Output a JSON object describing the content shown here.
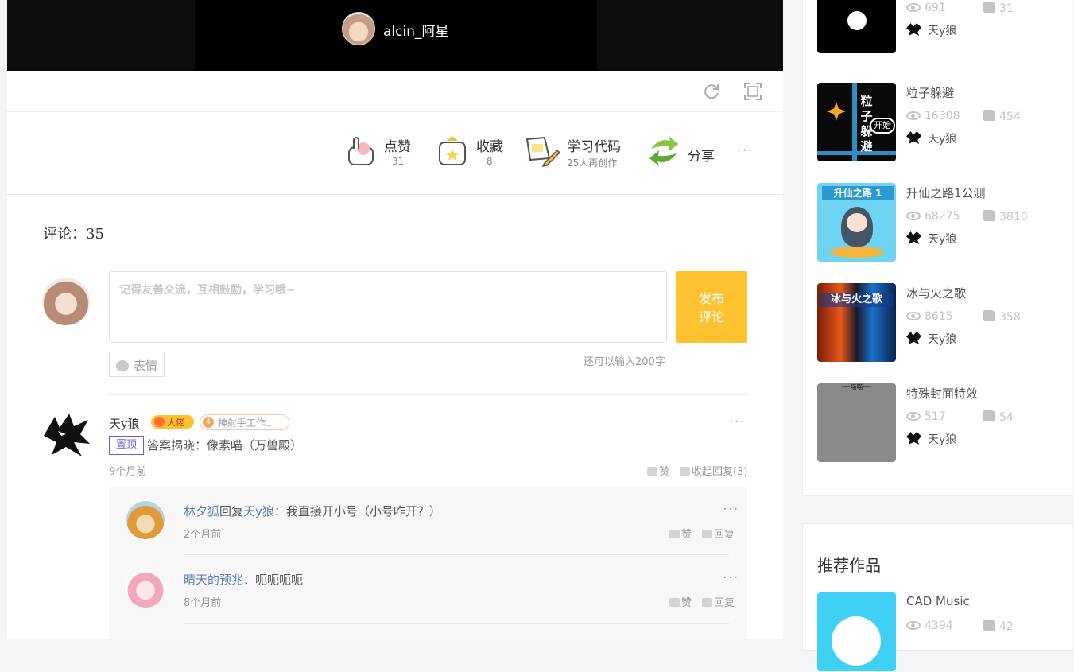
{
  "player": {
    "author_name": "alcin_阿星"
  },
  "actions": {
    "like_label": "点赞",
    "like_count": "31",
    "fav_label": "收藏",
    "fav_count": "8",
    "learn_label": "学习代码",
    "learn_sub": "25人再创作",
    "share_label": "分享"
  },
  "comments": {
    "count_label": "评论：",
    "count_value": "35",
    "placeholder": "记得友善交流，互相鼓励，学习哦~",
    "submit_line1": "发布",
    "submit_line2": "评论",
    "emoji_label": "表情",
    "char_left": "还可以输入200字"
  },
  "top_comment": {
    "author": "天y狼",
    "badge_boss": "大佬",
    "badge_level": "4",
    "badge_title": "神射手工作...",
    "pin": "置顶",
    "text": "答案揭晓：像素喵（万兽殿）",
    "time": "9个月前",
    "like": "赞",
    "collapse": "收起回复(3)"
  },
  "replies": [
    {
      "author": "林夕狐",
      "connector": "回复",
      "target": "天y狼",
      "text": "：我直接开小号（小号咋开？）",
      "time": "2个月前",
      "like": "赞",
      "reply": "回复"
    },
    {
      "author": "晴天的预兆",
      "connector": "",
      "target": "",
      "text": "：呃呃呃呃",
      "time": "8个月前",
      "like": "赞",
      "reply": "回复"
    }
  ],
  "sidebar": {
    "works": [
      {
        "title": "",
        "views": "691",
        "likes": "31",
        "author": "天y狼"
      },
      {
        "title": "粒子躲避",
        "views": "16308",
        "likes": "454",
        "author": "天y狼",
        "thumb_text": "粒子躲避",
        "thumb_btn": "开始"
      },
      {
        "title": "升仙之路1公测",
        "views": "68275",
        "likes": "3810",
        "author": "天y狼",
        "thumb_text": "升仙之路 1"
      },
      {
        "title": "冰与火之歌",
        "views": "8615",
        "likes": "358",
        "author": "天y狼",
        "thumb_text": "冰与火之歌"
      },
      {
        "title": "特殊封面特效",
        "views": "517",
        "likes": "54",
        "author": "天y狼",
        "thumb_text": "-—喵喵—-"
      }
    ],
    "recommend_title": "推荐作品",
    "recommend": [
      {
        "title": "CAD Music",
        "views": "4394",
        "likes": "42"
      }
    ]
  },
  "colors": {
    "accent": "#fec130",
    "link": "#5b7fb5",
    "pin": "#6b5fd9"
  }
}
